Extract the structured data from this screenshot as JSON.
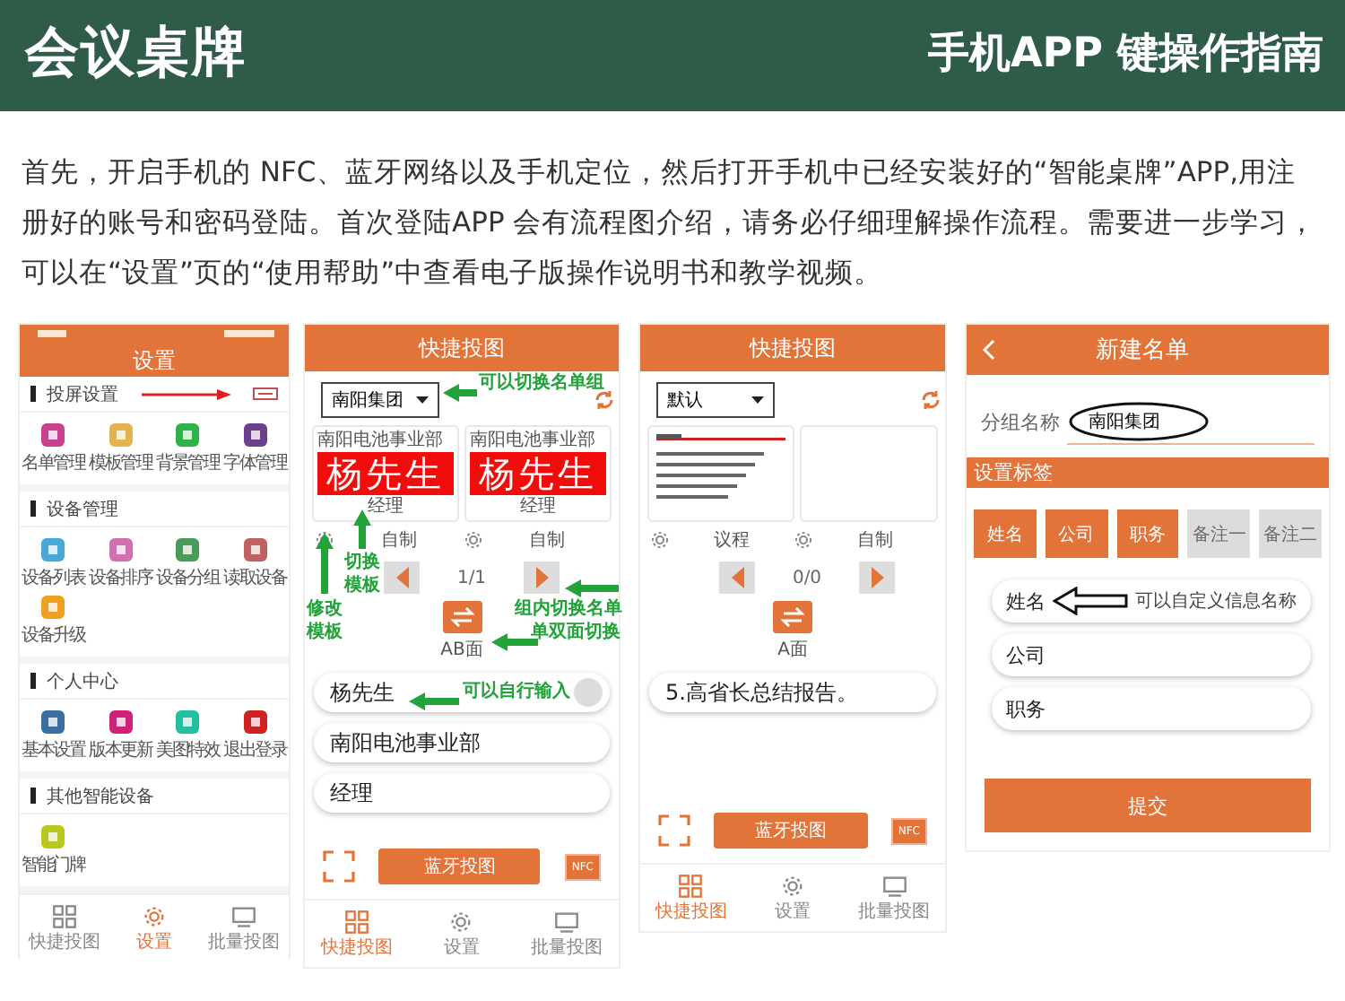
{
  "header": {
    "title": "会议桌牌",
    "subtitle": "手机APP 键操作指南"
  },
  "intro": "首先，开启手机的 NFC、蓝牙网络以及手机定位，然后打开手机中已经安装好的“智能桌牌”APP,用注册好的账号和密码登陆。首次登陆APP 会有流程图介绍，请务必仔细理解操作流程。需要进一步学习，可以在“设置”页的“使用帮助”中查看电子版操作说明书和教学视频。",
  "settings_screen": {
    "title": "设置",
    "sections": [
      {
        "title": "投屏设置",
        "items": [
          {
            "label": "名单管理",
            "color": "#c8408f"
          },
          {
            "label": "模板管理",
            "color": "#e2b450"
          },
          {
            "label": "背景管理",
            "color": "#2fb24a"
          },
          {
            "label": "字体管理",
            "color": "#6a3f8c"
          }
        ]
      },
      {
        "title": "设备管理",
        "items": [
          {
            "label": "设备列表",
            "color": "#48a8d8"
          },
          {
            "label": "设备排序",
            "color": "#d070b0"
          },
          {
            "label": "设备分组",
            "color": "#4a9a5a"
          },
          {
            "label": "读取设备",
            "color": "#c06060"
          },
          {
            "label": "设备升级",
            "color": "#f0a020"
          }
        ]
      },
      {
        "title": "个人中心",
        "items": [
          {
            "label": "基本设置",
            "color": "#3a6fa0"
          },
          {
            "label": "版本更新",
            "color": "#d0207a"
          },
          {
            "label": "美图特效",
            "color": "#20c0a0"
          },
          {
            "label": "退出登录",
            "color": "#d02020"
          }
        ]
      },
      {
        "title": "其他智能设备",
        "items": [
          {
            "label": "智能门牌",
            "color": "#b8c820"
          }
        ]
      }
    ],
    "tabs": [
      {
        "label": "快捷投图",
        "selected": false
      },
      {
        "label": "设置",
        "selected": true
      },
      {
        "label": "批量投图",
        "selected": false
      }
    ]
  },
  "quick_screens": [
    {
      "title": "快捷投图",
      "group": "南阳集团",
      "cards": [
        {
          "kind": "name_card",
          "org": "南阳电池事业部",
          "name": "杨先生",
          "position": "经理",
          "template": "自制"
        },
        {
          "kind": "name_card",
          "org": "南阳电池事业部",
          "name": "杨先生",
          "position": "经理",
          "template": "自制"
        }
      ],
      "page": "1/1",
      "mode": "AB面",
      "fields": [
        {
          "value": "杨先生",
          "has_button": true
        },
        {
          "value": "南阳电池事业部",
          "has_button": false
        },
        {
          "value": "经理",
          "has_button": false
        }
      ],
      "send_button": "蓝牙投图",
      "nfc": "NFC",
      "tabs": [
        {
          "label": "快捷投图",
          "selected": true
        },
        {
          "label": "设置",
          "selected": false
        },
        {
          "label": "批量投图",
          "selected": false
        }
      ],
      "annotations": [
        {
          "text": "可以切换名单组"
        },
        {
          "text": "切换模板"
        },
        {
          "text": "修改模板"
        },
        {
          "text": "组内切换名单"
        },
        {
          "text": "单双面切换"
        },
        {
          "text": "可以自行输入"
        }
      ]
    },
    {
      "title": "快捷投图",
      "group": "默认",
      "cards": [
        {
          "kind": "agenda",
          "template": "议程"
        },
        {
          "kind": "blank",
          "template": "自制"
        }
      ],
      "page": "0/0",
      "mode": "A面",
      "fields": [
        {
          "value": "5.高省长总结报告。",
          "has_button": false
        }
      ],
      "send_button": "蓝牙投图",
      "nfc": "NFC",
      "tabs": [
        {
          "label": "快捷投图",
          "selected": true
        },
        {
          "label": "设置",
          "selected": false
        },
        {
          "label": "批量投图",
          "selected": false
        }
      ]
    }
  ],
  "new_list_screen": {
    "title": "新建名单",
    "group_label": "分组名称",
    "group_value": "南阳集团",
    "tags_title": "设置标签",
    "tags": [
      {
        "label": "姓名",
        "selected": true
      },
      {
        "label": "公司",
        "selected": true
      },
      {
        "label": "职务",
        "selected": true
      },
      {
        "label": "备注一",
        "selected": false
      },
      {
        "label": "备注二",
        "selected": false
      }
    ],
    "fields": [
      "姓名",
      "公司",
      "职务"
    ],
    "note": "可以自定义信息名称",
    "submit": "提交"
  }
}
